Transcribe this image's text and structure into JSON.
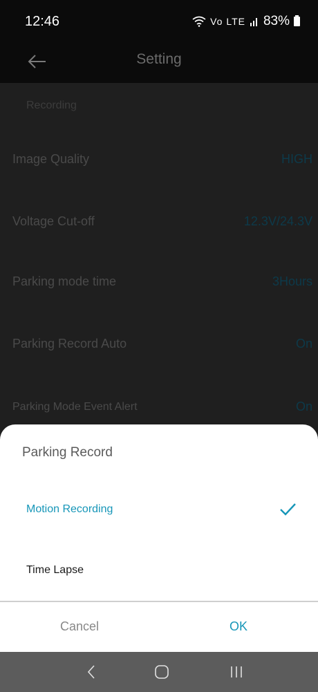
{
  "status_bar": {
    "time": "12:46",
    "network": "Vo LTE",
    "battery": "83%"
  },
  "header": {
    "title": "Setting"
  },
  "list": {
    "section": "Recording",
    "rows": [
      {
        "label": "Image Quality",
        "value": "HIGH"
      },
      {
        "label": "Voltage Cut-off",
        "value": "12.3V/24.3V"
      },
      {
        "label": "Parking mode time",
        "value": "3Hours"
      },
      {
        "label": "Parking Record Auto",
        "value": "On"
      },
      {
        "label": "Parking Mode Event Alert",
        "value": "On"
      }
    ]
  },
  "sheet": {
    "title": "Parking Record",
    "options": [
      {
        "label": "Motion Recording",
        "selected": true
      },
      {
        "label": "Time Lapse",
        "selected": false
      }
    ],
    "cancel_label": "Cancel",
    "ok_label": "OK"
  },
  "colors": {
    "accent": "#1696b8",
    "sheet_bg": "#ffffff",
    "overlay_bg": "#1f1f1f",
    "navbar_bg": "#5c5c5c"
  }
}
